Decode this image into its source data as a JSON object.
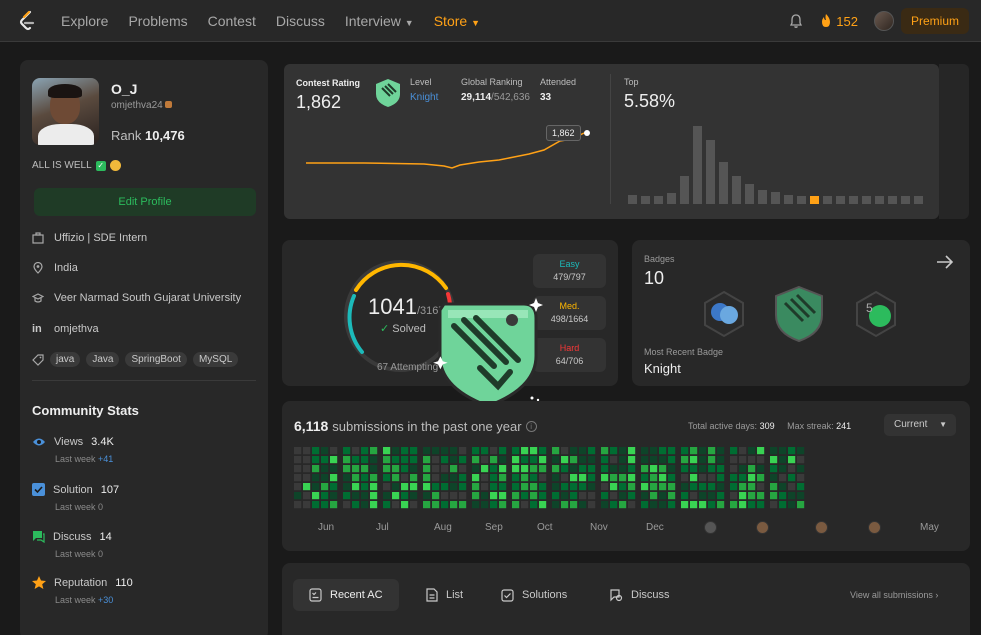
{
  "nav": {
    "links": [
      "Explore",
      "Problems",
      "Contest",
      "Discuss",
      "Interview",
      "Store"
    ],
    "streak": "152",
    "premium": "Premium"
  },
  "profile": {
    "name": "O_J",
    "handle": "omjethva24",
    "rank_label": "Rank",
    "rank": "10,476",
    "bio": "ALL IS WELL",
    "edit_label": "Edit Profile",
    "company": "Uffizio | SDE Intern",
    "location": "India",
    "school": "Veer Narmad South Gujarat University",
    "linkedin": "omjethva",
    "skills": [
      "java",
      "Java",
      "SpringBoot",
      "MySQL"
    ]
  },
  "community": {
    "title": "Community Stats",
    "stats": [
      {
        "label": "Views",
        "value": "3.4K",
        "sub": "Last week",
        "delta": "+41",
        "icon": "eye-icon",
        "color": "#4a90d9"
      },
      {
        "label": "Solution",
        "value": "107",
        "sub": "Last week",
        "delta": "0",
        "icon": "check-square-icon",
        "color": "#4a90d9"
      },
      {
        "label": "Discuss",
        "value": "14",
        "sub": "Last week",
        "delta": "0",
        "icon": "discuss-icon",
        "color": "#2cbb5d"
      },
      {
        "label": "Reputation",
        "value": "110",
        "sub": "Last week",
        "delta": "+30",
        "icon": "star-icon",
        "color": "#ffa116"
      }
    ]
  },
  "contest": {
    "rating_label": "Contest Rating",
    "rating": "1,862",
    "level_label": "Level",
    "level": "Knight",
    "global_label": "Global Ranking",
    "global_rank": "29,114",
    "global_total": "/542,636",
    "attended_label": "Attended",
    "attended": "33",
    "top_label": "Top",
    "top": "5.58%",
    "tooltip": "1,862"
  },
  "solved": {
    "count": "1041",
    "total": "/3167",
    "solved_label": "Solved",
    "attempting": "67 Attempting",
    "difficulties": [
      {
        "name": "Easy",
        "value": "479/797",
        "color": "#1cbaba"
      },
      {
        "name": "Med.",
        "value": "498/1664",
        "color": "#ffb700"
      },
      {
        "name": "Hard",
        "value": "64/706",
        "color": "#f63737"
      }
    ]
  },
  "badges": {
    "label": "Badges",
    "count": "10",
    "recent_label": "Most Recent Badge",
    "recent": "Knight"
  },
  "submissions": {
    "count": "6,118",
    "title": "submissions in the past one year",
    "active_label": "Total active days:",
    "active": "309",
    "streak_label": "Max streak:",
    "streak": "241",
    "current": "Current",
    "months": [
      "Jun",
      "Jul",
      "Aug",
      "Sep",
      "Oct",
      "Nov",
      "Dec",
      "May"
    ]
  },
  "tabs": {
    "items": [
      "Recent AC",
      "List",
      "Solutions",
      "Discuss"
    ],
    "view_all": "View all submissions"
  }
}
